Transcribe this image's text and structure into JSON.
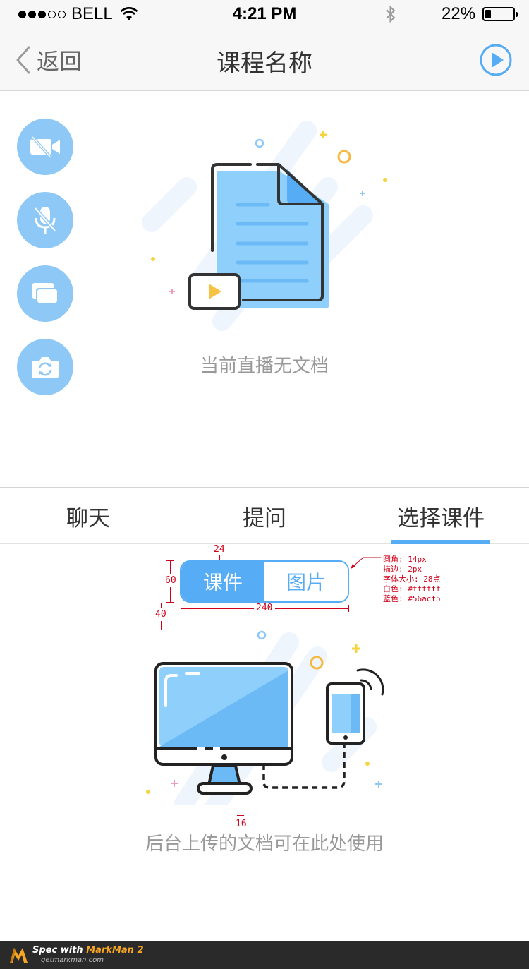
{
  "status_bar": {
    "carrier": "BELL",
    "time": "4:21 PM",
    "battery_percent_label": "22%",
    "battery_level": 0.22,
    "signal_bars_filled": 3,
    "signal_bars_total": 5
  },
  "nav": {
    "back_label": "返回",
    "title": "课程名称",
    "play_icon": "play-circle-icon"
  },
  "live": {
    "side_buttons": [
      "camera-off-icon",
      "mic-off-icon",
      "windows-icon",
      "switch-camera-icon"
    ],
    "empty_text": "当前直播无文档"
  },
  "tabs": {
    "items": [
      "聊天",
      "提问",
      "选择课件"
    ],
    "active_index": 2
  },
  "segmented": {
    "options": [
      "课件",
      "图片"
    ],
    "active_index": 0
  },
  "annotations": {
    "gap_top": "24",
    "height": "60",
    "gap_bottom": "40",
    "width": "240",
    "gap_text": "16",
    "notes": [
      "圆角: 14px",
      "描边: 2px",
      "字体大小: 28点",
      "白色: #ffffff",
      "蓝色: #56acf5"
    ]
  },
  "upload": {
    "text": "后台上传的文档可在此处使用"
  },
  "colors": {
    "accent": "#56acf5",
    "light_blue": "#8ec8f6",
    "annotation_red": "#d0021b"
  },
  "footer": {
    "brand_prefix": "Spec with ",
    "brand_name": "MarkMan 2",
    "url": "getmarkman.com"
  }
}
